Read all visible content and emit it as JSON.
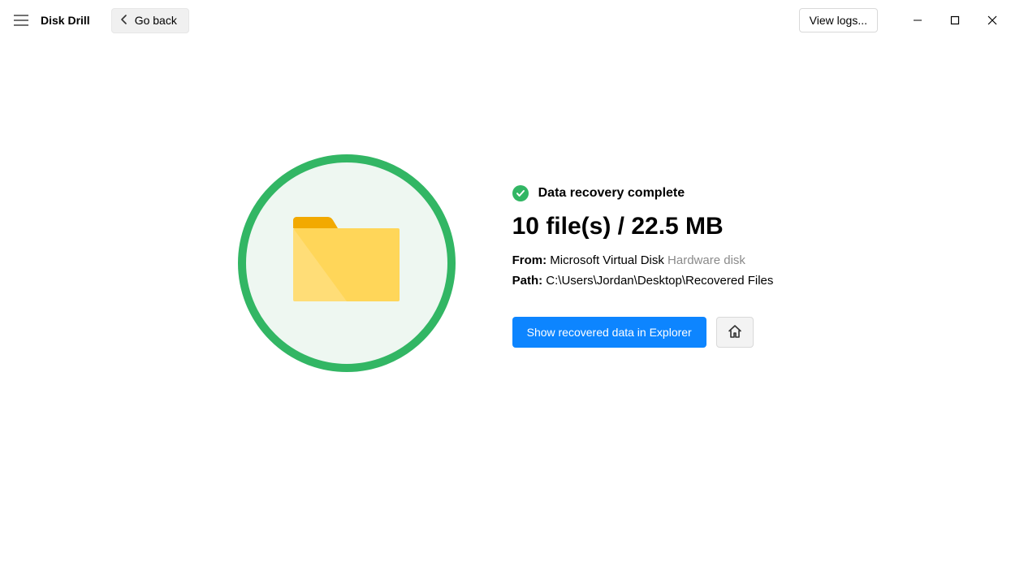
{
  "titlebar": {
    "app_title": "Disk Drill",
    "go_back": "Go back",
    "view_logs": "View logs..."
  },
  "status": {
    "label": "Data recovery complete"
  },
  "summary": "10 file(s) / 22.5 MB",
  "from": {
    "label": "From:",
    "value": "Microsoft Virtual Disk",
    "type": "Hardware disk"
  },
  "path": {
    "label": "Path:",
    "value": "C:\\Users\\Jordan\\Desktop\\Recovered Files"
  },
  "actions": {
    "show_in_explorer": "Show recovered data in Explorer"
  }
}
